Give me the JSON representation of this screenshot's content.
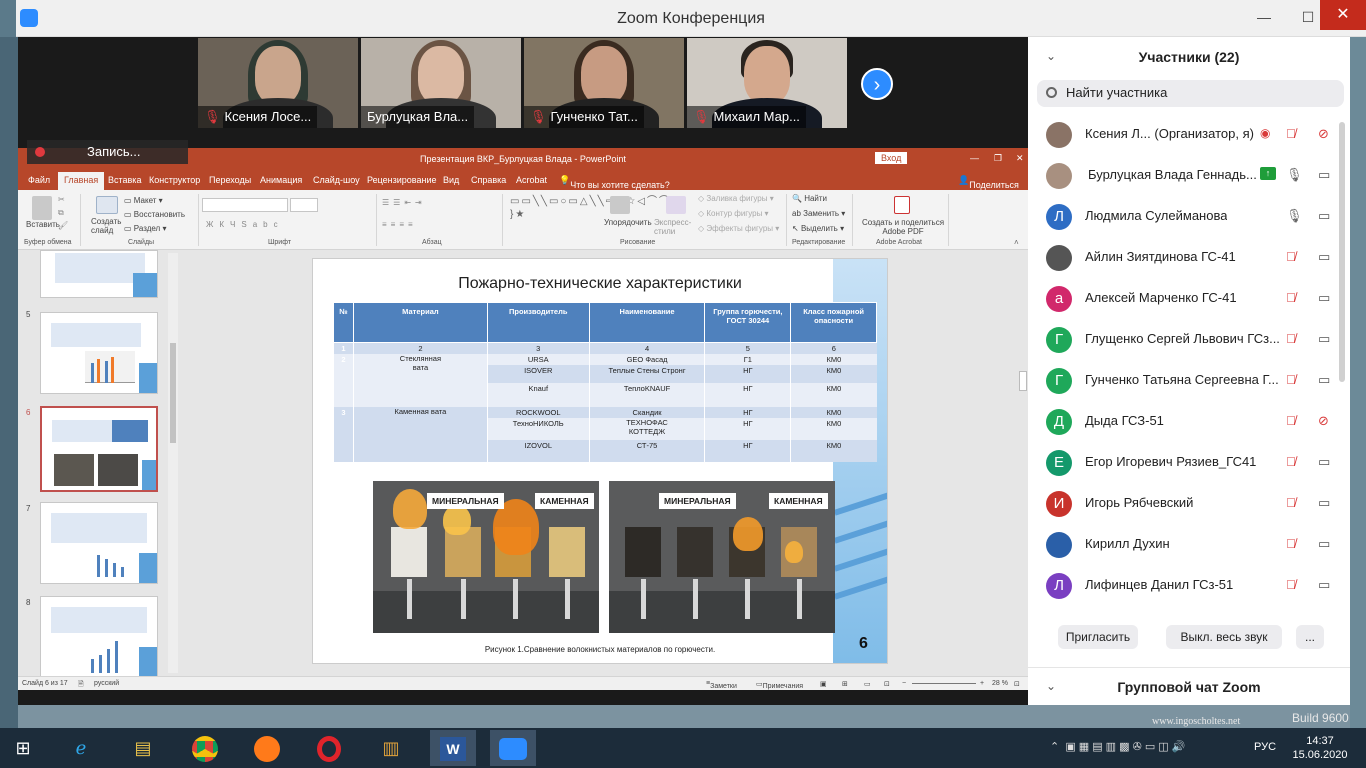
{
  "window": {
    "title": "Zoom Конференция",
    "min": "—",
    "max": "☐",
    "close": "✕"
  },
  "video_strip": {
    "participants": [
      {
        "name": "Ксения Лосе..."
      },
      {
        "name": "Бурлуцкая Вла..."
      },
      {
        "name": "Гунченко Тат..."
      },
      {
        "name": "Михаил Мар..."
      }
    ],
    "next_arrow": "›",
    "recording": "Запись..."
  },
  "ppt": {
    "title": "Презентация ВКР_Бурлуцкая Влада  -  PowerPoint",
    "login": "Вход",
    "tabs": [
      "Файл",
      "Главная",
      "Вставка",
      "Конструктор",
      "Переходы",
      "Анимация",
      "Слайд-шоу",
      "Рецензирование",
      "Вид",
      "Справка",
      "Acrobat",
      "Что вы хотите сделать?"
    ],
    "share": "Поделиться",
    "ribbon": {
      "paste": "Вставить",
      "create_slide": "Создать слайд",
      "layout": "Макет",
      "restore": "Восстановить",
      "section": "Раздел",
      "font_size_placeholder": "",
      "arrange": "Упорядочить",
      "express_styles": "Экспресс-стили",
      "fill": "Заливка фигуры",
      "outline": "Контур фигуры",
      "effects": "Эффекты фигуры",
      "find": "Найти",
      "replace": "Заменить",
      "select": "Выделить",
      "acrobat": "Создать и поделиться Adobe PDF",
      "groups": [
        "Буфер обмена",
        "Слайды",
        "Шрифт",
        "Абзац",
        "Рисование",
        "Редактирование",
        "Adobe Acrobat"
      ]
    },
    "slide_numbers": [
      "5",
      "6",
      "7",
      "8"
    ],
    "status": {
      "slide": "Слайд 6 из 17",
      "lang": "русский",
      "notes": "Заметки",
      "comments": "Примечания",
      "zoom": "28 %"
    }
  },
  "slide": {
    "title": "Пожарно-технические характеристики",
    "headers": [
      "№",
      "Материал",
      "Производитель",
      "Наименование",
      "Группа горючести, ГОСТ 30244",
      "Класс пожарной опасности"
    ],
    "index_row": [
      "1",
      "2",
      "3",
      "4",
      "5",
      "6"
    ],
    "group1_num": "2",
    "group1_material": "Стеклянная вата",
    "group1": [
      [
        "URSA",
        "GEO Фасад",
        "Г1",
        "КМ0"
      ],
      [
        "ISOVER",
        "Теплые Стены Стронг",
        "НГ",
        "КМ0"
      ],
      [
        "Knauf",
        "ТеплоKNAUF",
        "НГ",
        "КМ0"
      ]
    ],
    "group2_num": "3",
    "group2_material": "Каменная вата",
    "group2": [
      [
        "ROCKWOOL",
        "Скандик",
        "НГ",
        "КМ0"
      ],
      [
        "ТехноНИКОЛЬ",
        "ТЕХНОФАС КОТТЕДЖ",
        "НГ",
        "КМ0"
      ],
      [
        "IZOVOL",
        "СТ-75",
        "НГ",
        "КМ0"
      ]
    ],
    "photo_labels": [
      "МИНЕРАЛЬНАЯ",
      "КАМЕННАЯ",
      "МИНЕРАЛЬНАЯ",
      "КАМЕННАЯ"
    ],
    "caption": "Рисунок 1.Сравнение волокнистых материалов по горючести.",
    "page_number": "6"
  },
  "participants_panel": {
    "title": "Участники (22)",
    "search_placeholder": "Найти участника",
    "list": [
      {
        "name": "Ксения Л...  (Организатор, я)",
        "letter": "",
        "color": "#7a6a60"
      },
      {
        "name": "Бурлуцкая Влада Геннадь...",
        "letter": "",
        "color": "#8a7a70"
      },
      {
        "name": "Людмила Сулейманова",
        "letter": "Л",
        "color": "#2e6dc4"
      },
      {
        "name": "Айлин Зиятдинова ГС-41",
        "letter": "",
        "color": "#555555"
      },
      {
        "name": "Алексей Марченко ГС-41",
        "letter": "а",
        "color": "#d1286b"
      },
      {
        "name": "Глущенко Сергей Львович ГСз...",
        "letter": "Г",
        "color": "#1fa85a"
      },
      {
        "name": "Гунченко Татьяна Сергеевна Г...",
        "letter": "Г",
        "color": "#1fa85a"
      },
      {
        "name": "Дыда ГСЗ-51",
        "letter": "Д",
        "color": "#1fa85a"
      },
      {
        "name": "Егор Игоревич Рязиев_ГС41",
        "letter": "Е",
        "color": "#14996b"
      },
      {
        "name": "Игорь Рябчевский",
        "letter": "И",
        "color": "#c8332c"
      },
      {
        "name": "Кирилл Духин",
        "letter": "",
        "color": "#2a5fa8"
      },
      {
        "name": "Лифинцев Данил ГСз-51",
        "letter": "Л",
        "color": "#7a3fc1"
      }
    ],
    "invite": "Пригласить",
    "mute_all": "Выкл. весь звук",
    "more": "...",
    "chat_title": "Групповой чат Zoom"
  },
  "taskbar": {
    "lang": "РУС",
    "time": "14:37",
    "date": "15.06.2020"
  },
  "desktop": {
    "watermark": "www.ingoscholtes.net",
    "build": "Build 9600"
  }
}
